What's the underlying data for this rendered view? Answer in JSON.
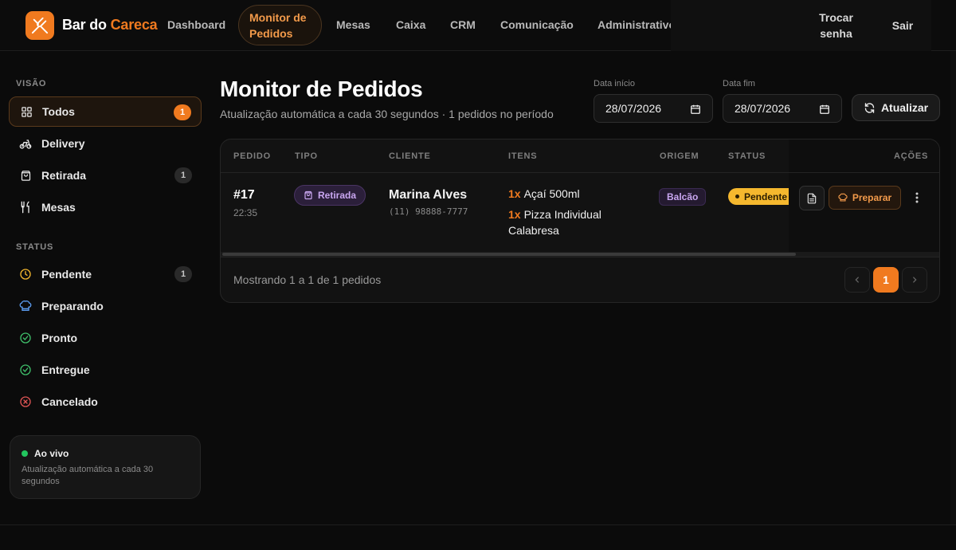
{
  "brand": {
    "part1": "Bar do",
    "part2": "Careca"
  },
  "nav": {
    "items": [
      "Dashboard",
      "Monitor de Pedidos",
      "Mesas",
      "Caixa",
      "CRM",
      "Comunicação",
      "Administrativo"
    ],
    "active": "Monitor de Pedidos",
    "change_password": "Trocar senha",
    "logout": "Sair"
  },
  "sidebar": {
    "section_view": "VISÃO",
    "view_items": [
      {
        "label": "Todos",
        "count": "1",
        "icon": "grid-icon",
        "active": true
      },
      {
        "label": "Delivery",
        "icon": "bike-icon"
      },
      {
        "label": "Retirada",
        "count": "1",
        "icon": "bag-icon"
      },
      {
        "label": "Mesas",
        "icon": "utensils-icon"
      }
    ],
    "section_status": "STATUS",
    "status_items": [
      {
        "label": "Pendente",
        "count": "1",
        "icon": "clock-icon"
      },
      {
        "label": "Preparando",
        "icon": "chef-hat-icon"
      },
      {
        "label": "Pronto",
        "icon": "check-circle-icon"
      },
      {
        "label": "Entregue",
        "icon": "check-circle-icon"
      },
      {
        "label": "Cancelado",
        "icon": "x-circle-icon"
      }
    ],
    "live": {
      "title": "Ao vivo",
      "subtitle": "Atualização automática a cada 30 segundos"
    }
  },
  "main": {
    "title": "Monitor de Pedidos",
    "subtitle": "Atualização automática a cada 30 segundos · 1 pedidos no período",
    "date_start_label": "Data início",
    "date_start": "28/07/2026",
    "date_end_label": "Data fim",
    "date_end": "28/07/2026",
    "refresh_label": "Atualizar"
  },
  "table": {
    "headers": [
      "PEDIDO",
      "TIPO",
      "CLIENTE",
      "ITENS",
      "ORIGEM",
      "STATUS",
      "AÇÕES"
    ],
    "rows": [
      {
        "number": "#17",
        "time": "22:35",
        "type": "Retirada",
        "client_name": "Marina Alves",
        "client_phone": "(11) 98888-7777",
        "items": [
          {
            "qty": "1x",
            "name": "Açaí 500ml"
          },
          {
            "qty": "1x",
            "name": "Pizza Individual Calabresa"
          }
        ],
        "origin": "Balcão",
        "status": "Pendente",
        "action_label": "Preparar"
      }
    ],
    "showing": "Mostrando 1 a 1 de 1 pedidos",
    "current_page": "1"
  },
  "colors": {
    "accent": "#f07a1f",
    "pending": "#f5b82e",
    "live": "#22c55e",
    "bg": "#0b0b0b"
  }
}
